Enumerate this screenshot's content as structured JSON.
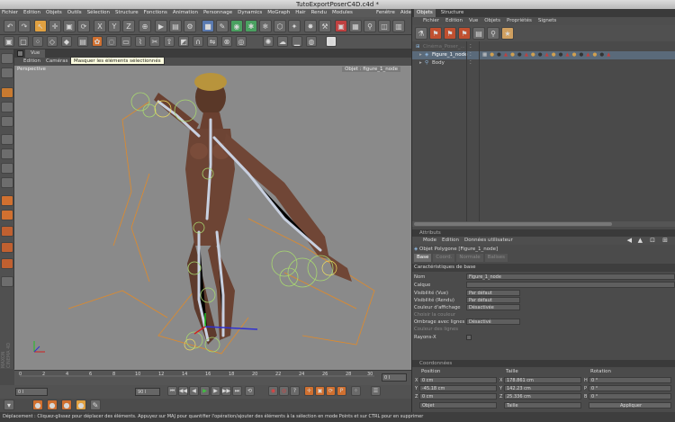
{
  "window_title": "TutoExportPoserC4D.c4d *",
  "menubar": [
    "Fichier",
    "Edition",
    "Objets",
    "Outils",
    "Sélection",
    "Structure",
    "Fonctions",
    "Animation",
    "Personnage",
    "Dynamics",
    "MoGraph",
    "Hair",
    "Rendu",
    "Modules externes",
    "Fenêtre",
    "Aide"
  ],
  "tooltip": "Masquer les éléments sélectionnés",
  "viewport": {
    "tab": "Vue",
    "menu": [
      "Edition",
      "Caméras"
    ],
    "label_left": "Perspective",
    "label_right": "Objet : figure_1_node"
  },
  "timeline": {
    "ticks": [
      "0",
      "2",
      "4",
      "6",
      "8",
      "10",
      "12",
      "14",
      "16",
      "18",
      "20",
      "22",
      "24",
      "26",
      "28",
      "30"
    ],
    "end_label": "0 I",
    "frame_start": "0 I",
    "frame_end": "90 I"
  },
  "statusbar": "Déplacement : Cliquez-glissez pour déplacer des éléments. Appuyez sur MAJ pour quantifier l'opération/ajouter des éléments à la sélection en mode Points et sur CTRL pour en supprimer",
  "object_panel": {
    "tabs": [
      "Objets",
      "Structure"
    ],
    "active_tab": 0,
    "menu": [
      "Fichier",
      "Edition",
      "Vue",
      "Objets",
      "Propriétés",
      "Signets"
    ],
    "objects": [
      {
        "name": "Cinéma_Poser_...",
        "indent": 0
      },
      {
        "name": "Figure_1_node",
        "indent": 1
      },
      {
        "name": "Body",
        "indent": 1
      }
    ]
  },
  "attr_panel": {
    "header": "Attributs",
    "menu": [
      "Mode",
      "Edition",
      "Données utilisateur"
    ],
    "object_title": "Objet Polygone [Figure_1_node]",
    "tabs": [
      "Base",
      "Coord.",
      "Normale",
      "Balises"
    ],
    "active_tab": 0,
    "section": "Caractéristiques de base",
    "fields": [
      {
        "label": "Nom",
        "value": "Figure_1_node"
      },
      {
        "label": "Calque",
        "value": ""
      },
      {
        "label": "Visibilité (Vue)",
        "value": "Par défaut"
      },
      {
        "label": "Visibilité (Rendu)",
        "value": "Par défaut"
      },
      {
        "label": "Couleur d'affichage",
        "value": "Désactivée"
      },
      {
        "label": "Choisir la couleur",
        "value": ""
      },
      {
        "label": "Ombrage avec lignes",
        "value": "Désactivé"
      },
      {
        "label": "Couleur des lignes",
        "value": ""
      },
      {
        "label": "Rayons-X",
        "value": ""
      }
    ]
  },
  "coord_panel": {
    "header": "Coordonnées",
    "columns": [
      "Position",
      "Taille",
      "Rotation"
    ],
    "rows": [
      {
        "pos_label": "X",
        "pos": "0 cm",
        "size_label": "X",
        "size": "178.861 cm",
        "rot_label": "H",
        "rot": "0 °"
      },
      {
        "pos_label": "Y",
        "pos": "-45.18 cm",
        "size_label": "Y",
        "size": "142.23 cm",
        "rot_label": "P",
        "rot": "0 °"
      },
      {
        "pos_label": "Z",
        "pos": "0 cm",
        "size_label": "Z",
        "size": "25.336 cm",
        "rot_label": "B",
        "rot": "0 °"
      }
    ],
    "mode": "Objet",
    "size_mode": "Taille",
    "apply": "Appliquer"
  },
  "colors": {
    "viewport_bg": "#8a8a8a",
    "panel_bg": "#4b4b4b",
    "accent_orange": "#e08a2a",
    "bone_green": "#a8d870"
  }
}
